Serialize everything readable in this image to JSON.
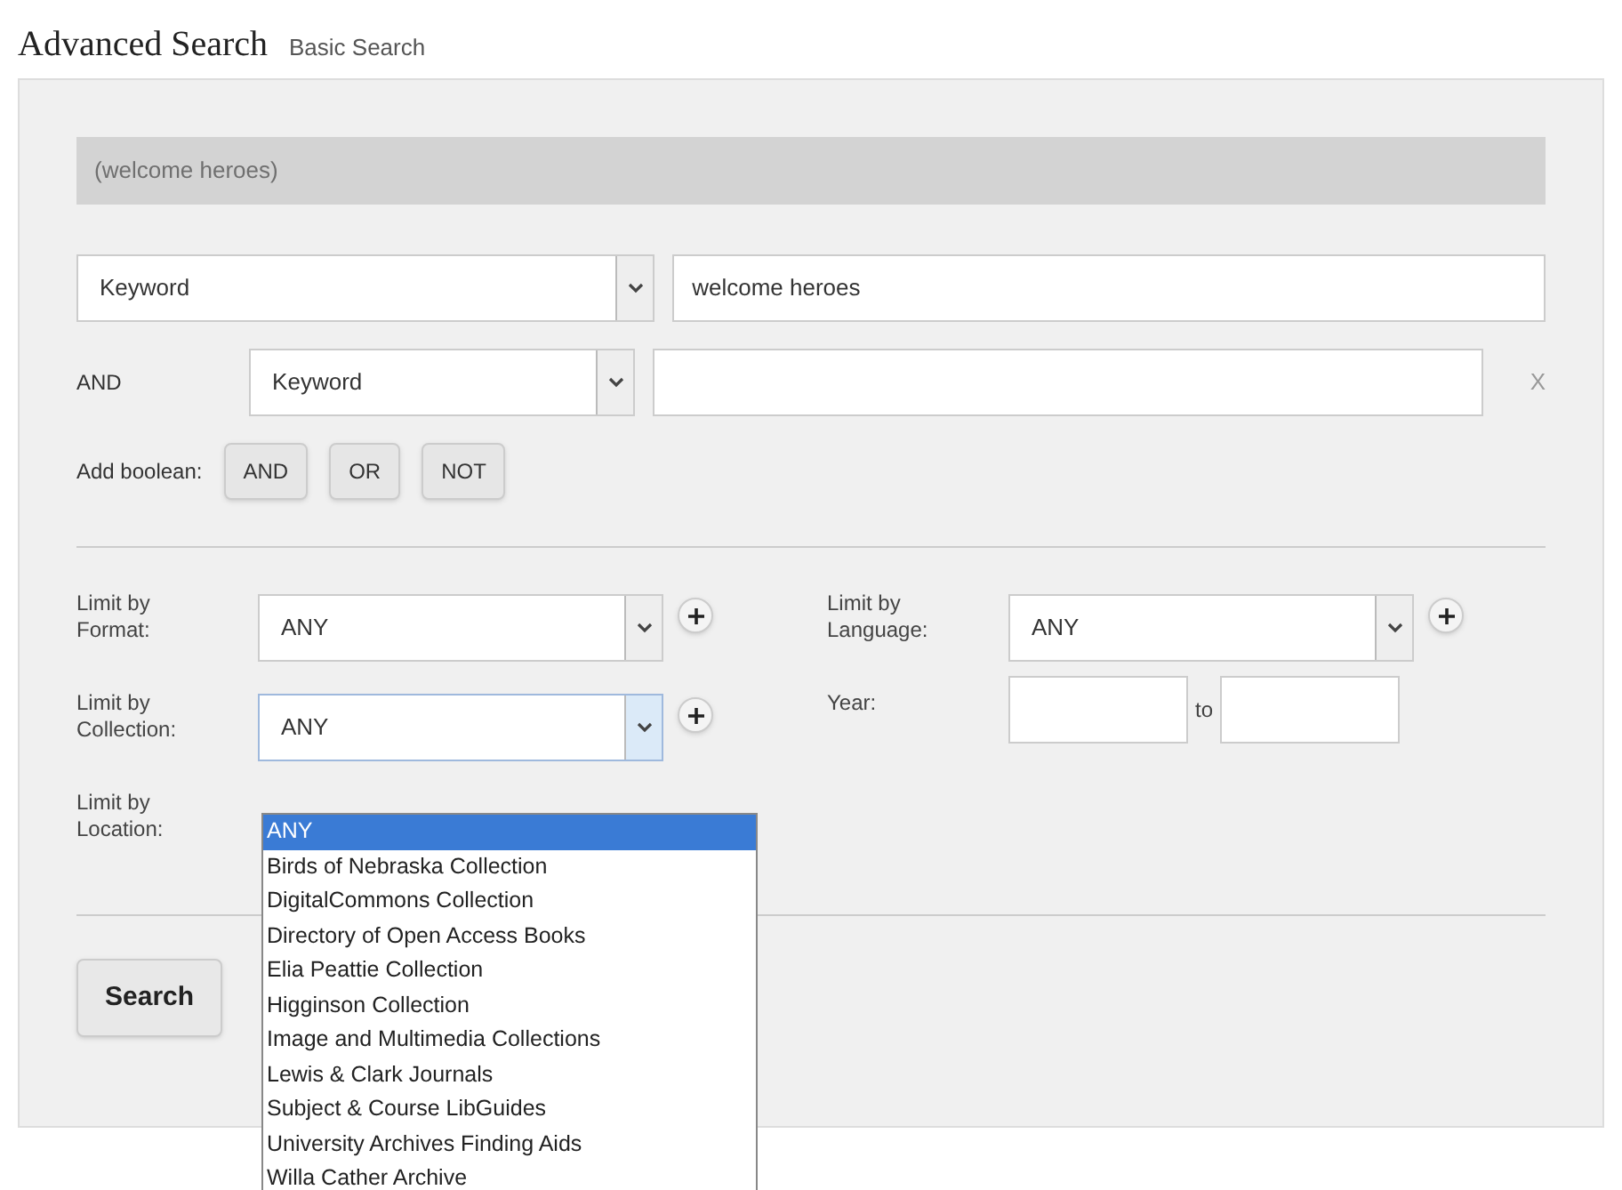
{
  "title": "Advanced Search",
  "basic_link": "Basic Search",
  "query_preview": "(welcome heroes)",
  "search_rows": [
    {
      "operator": null,
      "field": "Keyword",
      "value": "welcome heroes"
    },
    {
      "operator": "AND",
      "field": "Keyword",
      "value": "",
      "remove_label": "X"
    }
  ],
  "add_boolean": {
    "label": "Add boolean:",
    "buttons": [
      "AND",
      "OR",
      "NOT"
    ]
  },
  "limits_left": [
    {
      "label": "Limit by Format:",
      "value": "ANY",
      "focused": false
    },
    {
      "label": "Limit by Collection:",
      "value": "ANY",
      "focused": true
    },
    {
      "label": "Limit by Location:"
    }
  ],
  "limits_right": [
    {
      "kind": "select",
      "label": "Limit by Language:",
      "value": "ANY"
    },
    {
      "kind": "range",
      "label": "Year:",
      "between": "to"
    }
  ],
  "dropdown": [
    {
      "label": "ANY",
      "selected": true
    },
    {
      "label": "Birds of Nebraska Collection",
      "selected": false
    },
    {
      "label": "DigitalCommons Collection",
      "selected": false
    },
    {
      "label": "Directory of Open Access Books",
      "selected": false
    },
    {
      "label": "Elia Peattie Collection",
      "selected": false
    },
    {
      "label": "Higginson Collection",
      "selected": false
    },
    {
      "label": "Image and Multimedia Collections",
      "selected": false
    },
    {
      "label": "Lewis & Clark Journals",
      "selected": false
    },
    {
      "label": "Subject & Course LibGuides",
      "selected": false
    },
    {
      "label": "University Archives Finding Aids",
      "selected": false
    },
    {
      "label": "Willa Cather Archive",
      "selected": false
    }
  ],
  "search_button": "Search"
}
